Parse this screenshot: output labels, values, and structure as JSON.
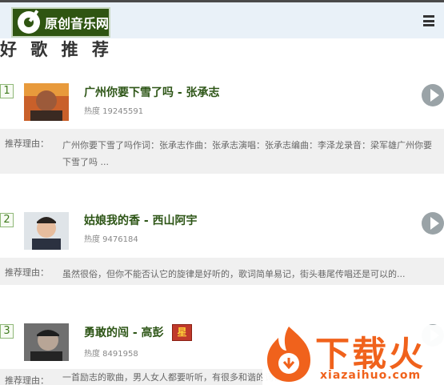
{
  "header": {
    "logo_text": "原创音乐网",
    "menu_icon": "menu-icon"
  },
  "section": {
    "title": "好 歌 推 荐"
  },
  "songs": [
    {
      "rank": "1",
      "title": "广州你要下雪了吗 - 张承志",
      "heat": "热度 19245591",
      "reason_label": "推荐理由：",
      "reason_text": "广州你要下雪了吗作词：张承志作曲：张承志演唱：张承志编曲：李泽龙录音：梁军雄广州你要下雪了吗 ..."
    },
    {
      "rank": "2",
      "title": "姑娘我的香 - 西山阿宇",
      "heat": "热度 9476184",
      "reason_label": "推荐理由：",
      "reason_text": "虽然很俗，但你不能否认它的旋律是好听的，歌词简单易记，街头巷尾传唱还是可以的..."
    },
    {
      "rank": "3",
      "title": "勇敢的闯 - 高彭",
      "badge": "星",
      "heat": "热度 8491958",
      "reason_label": "推荐理由：",
      "reason_text": "一首励志的歌曲，男人女人都要听听，有很多和谐的词语"
    }
  ],
  "watermark": {
    "text": "下载火",
    "url": "xiazaihuo.com"
  },
  "colors": {
    "topbar": "#e9f1f8",
    "logo_bg": "#2f5512",
    "title_green": "#2d5516",
    "rank_border": "#8fb878",
    "reason_bg": "#f0f0f0",
    "badge_red": "#c0392b",
    "watermark_orange": "#f0621c"
  }
}
